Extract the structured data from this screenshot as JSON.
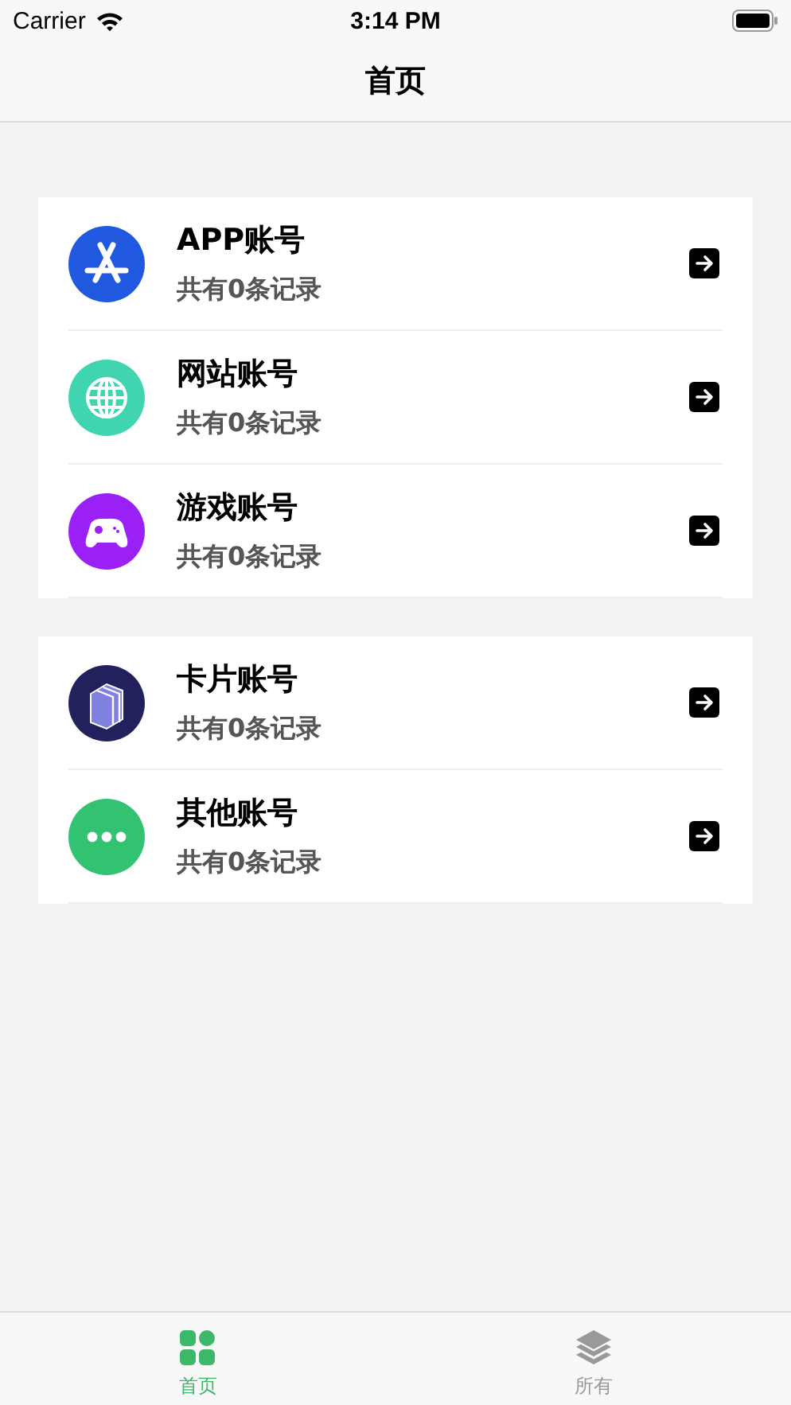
{
  "status_bar": {
    "carrier": "Carrier",
    "time": "3:14 PM"
  },
  "nav": {
    "title": "首页"
  },
  "groups": [
    {
      "items": [
        {
          "kind": "app",
          "color": "#2059e0",
          "title": "APP账号",
          "subtitle": "共有0条记录"
        },
        {
          "kind": "web",
          "color": "#40d5b0",
          "title": "网站账号",
          "subtitle": "共有0条记录"
        },
        {
          "kind": "game",
          "color": "#9b20f5",
          "title": "游戏账号",
          "subtitle": "共有0条记录"
        }
      ]
    },
    {
      "items": [
        {
          "kind": "card",
          "color": "#22215e",
          "title": "卡片账号",
          "subtitle": "共有0条记录"
        },
        {
          "kind": "other",
          "color": "#33c172",
          "title": "其他账号",
          "subtitle": "共有0条记录"
        }
      ]
    }
  ],
  "tabs": [
    {
      "kind": "home",
      "label": "首页",
      "selected": true
    },
    {
      "kind": "all",
      "label": "所有",
      "selected": false
    }
  ]
}
